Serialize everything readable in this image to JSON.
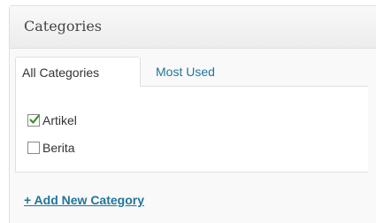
{
  "panel": {
    "title": "Categories"
  },
  "tabs": {
    "all_label": "All Categories",
    "most_used_label": "Most Used"
  },
  "categories": [
    {
      "label": "Artikel",
      "checked": true
    },
    {
      "label": "Berita",
      "checked": false
    }
  ],
  "add_link_label": "+ Add New Category",
  "colors": {
    "link": "#21759b",
    "check": "#3a8e2b",
    "border": "#dfdfdf"
  }
}
